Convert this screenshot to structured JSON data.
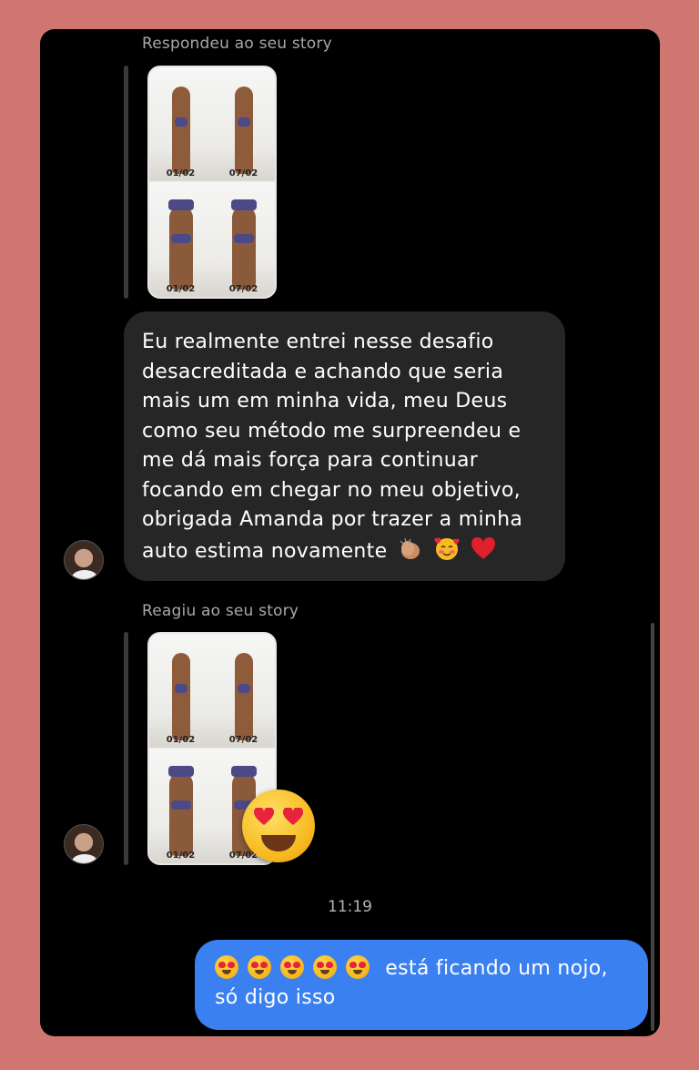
{
  "thread": {
    "first_context_label": "Respondeu ao seu story",
    "second_context_label": "Reagiu ao seu story",
    "story_dates": [
      "01/02",
      "07/02",
      "01/02",
      "07/02"
    ],
    "incoming_message": {
      "lines": [
        "Eu realmente entrei nesse desafio",
        "desacreditada e achando que seria",
        "mais um em minha vida, meu Deus",
        "como seu método me surpreendeu e",
        "me dá mais força para continuar",
        "focando em chegar no meu objetivo,",
        "obrigada Amanda por trazer a minha",
        "auto estima novamente"
      ],
      "emojis": [
        "clapping-hands",
        "smiling-face-with-hearts",
        "red-heart"
      ]
    },
    "reaction_emoji": "smiling-face-with-heart-eyes",
    "timestamp": "11:19",
    "outgoing_message": {
      "line1": "está ficando um nojo,",
      "line2": "só digo isso",
      "leading_emoji_count": 5
    }
  },
  "colors": {
    "page_background": "#d07670",
    "screen_background": "#000000",
    "incoming_bubble": "#262626",
    "outgoing_bubble": "#3a80f0",
    "context_label": "#a8a8a8"
  }
}
